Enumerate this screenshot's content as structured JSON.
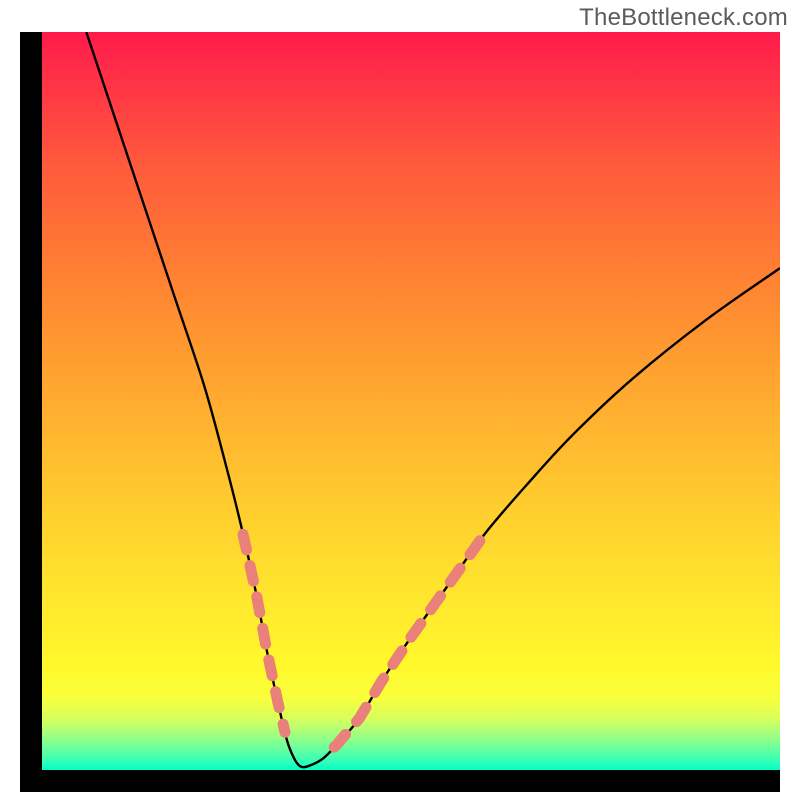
{
  "watermark": {
    "text": "TheBottleneck.com"
  },
  "chart_data": {
    "type": "line",
    "title": "",
    "xlabel": "",
    "ylabel": "",
    "xlim": [
      0,
      100
    ],
    "ylim": [
      0,
      100
    ],
    "curve": {
      "x": [
        6,
        10,
        14,
        18,
        22,
        25,
        27,
        29,
        30.5,
        32,
        33.2,
        34.2,
        35,
        36,
        38,
        40,
        43,
        46,
        50,
        55,
        60,
        66,
        72,
        80,
        90,
        100
      ],
      "y": [
        100,
        88,
        76,
        64,
        52,
        41,
        33,
        24,
        16,
        9,
        4,
        1.5,
        0.5,
        0.5,
        1.5,
        3.5,
        7,
        12,
        18,
        25,
        32,
        39,
        45.5,
        53,
        61,
        68
      ],
      "note": "V-shaped bottleneck curve; x is relative axis position (0-100 left→right), y is 0 at bottom (green) to 100 at top (red). Minimum near x≈35."
    },
    "overlay_dots": {
      "description": "Salmon-colored dashed/dot segments overlaid on lower part of both arms of the V",
      "color": "#e98079",
      "left_arm_range_y": [
        5,
        32
      ],
      "right_arm_range_y": [
        3,
        33
      ]
    },
    "colors": {
      "frame": "#000000",
      "gradient_top": "#ff1a4b",
      "gradient_bottom": "#00ffc9",
      "curve": "#000000",
      "dots": "#e98079"
    }
  }
}
